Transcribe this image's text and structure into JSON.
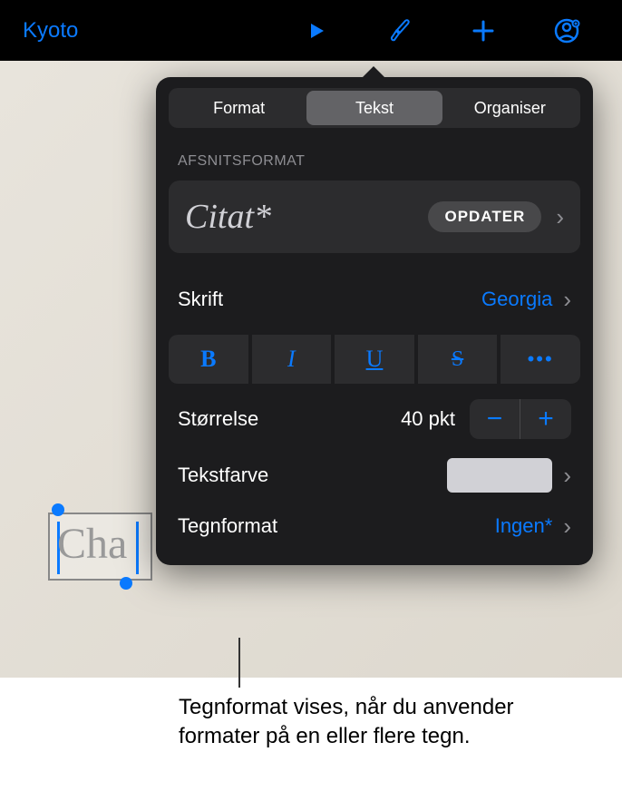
{
  "toolbar": {
    "title": "Kyoto"
  },
  "popover": {
    "tabs": {
      "format": "Format",
      "text": "Tekst",
      "organize": "Organiser"
    },
    "section_label": "AFSNITSFORMAT",
    "style": {
      "name": "Citat*",
      "update": "OPDATER"
    },
    "font": {
      "label": "Skrift",
      "value": "Georgia"
    },
    "font_buttons": {
      "bold": "B",
      "italic": "I",
      "underline": "U",
      "strike": "S",
      "more": "•••"
    },
    "size": {
      "label": "Størrelse",
      "value": "40 pkt"
    },
    "text_color": {
      "label": "Tekstfarve"
    },
    "char_format": {
      "label": "Tegnformat",
      "value": "Ingen*"
    }
  },
  "selection_text": "Cha",
  "callout": "Tegnformat vises, når du anvender formater på en eller flere tegn.",
  "colors": {
    "accent": "#0a7aff"
  }
}
